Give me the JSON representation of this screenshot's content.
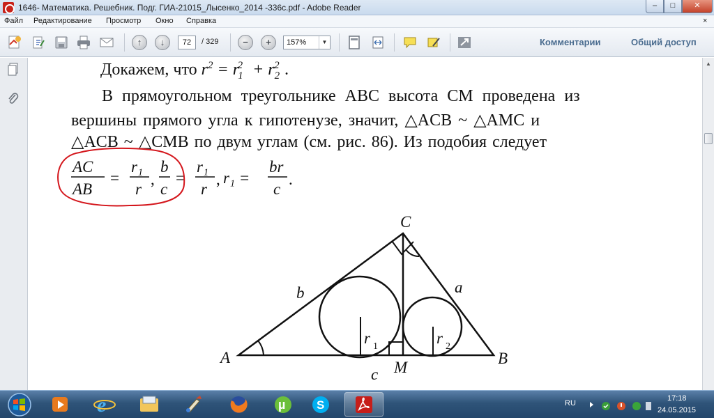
{
  "window": {
    "title": "1646- Математика. Решебник. Подг. ГИА-21015_Лысенко_2014 -336с.pdf - Adobe Reader",
    "min": "–",
    "max": "□",
    "close": "✕"
  },
  "menu": {
    "items": [
      "Файл",
      "Редактирование",
      "Просмотр",
      "Окно",
      "Справка"
    ],
    "close": "×"
  },
  "toolbar": {
    "page_current": "72",
    "page_total": "/ 329",
    "zoom": "157%",
    "zoom_minus": "−",
    "zoom_plus": "+",
    "comments": "Комментарии",
    "share": "Общий доступ",
    "icons": [
      "create-pdf-icon",
      "edit-icon",
      "save-icon",
      "print-icon",
      "email-icon",
      "prev-page-icon",
      "next-page-icon",
      "fit-page-icon",
      "fit-width-icon",
      "comment-icon",
      "sign-icon",
      "fullscreen-icon"
    ]
  },
  "document": {
    "line1_pre": "Докажем, что ",
    "line2": "В прямоугольном треугольнике ABC высота CM проведена из",
    "line3": "вершины прямого угла к гипотенузе, значит, △ACB  ~  △AMC  и",
    "line4": "△ACB  ~  △CMB по двум углам (см. рис. 86). Из подобия следует",
    "frac1_num": "AC",
    "frac1_den": "AB",
    "frac2_num": "r₁",
    "frac2_den": "r",
    "frac3_num": "b",
    "frac3_den": "c",
    "frac4_num": "r₁",
    "frac4_den": "r",
    "r1_eq": "r₁ =",
    "frac5_num": "br",
    "frac5_den": "c"
  },
  "figure": {
    "label_C": "C",
    "label_A": "A",
    "label_B": "B",
    "label_M": "M",
    "label_a": "a",
    "label_b": "b",
    "label_c": "c",
    "label_r1": "r",
    "label_r1_sub": "1",
    "label_r2": "r",
    "label_r2_sub": "2"
  },
  "taskbar": {
    "lang": "RU",
    "time": "17:18",
    "date": "24.05.2015",
    "apps": [
      "media-player-icon",
      "internet-explorer-icon",
      "file-explorer-icon",
      "paint-icon",
      "firefox-icon",
      "utorrent-icon",
      "skype-icon",
      "adobe-reader-icon"
    ]
  }
}
